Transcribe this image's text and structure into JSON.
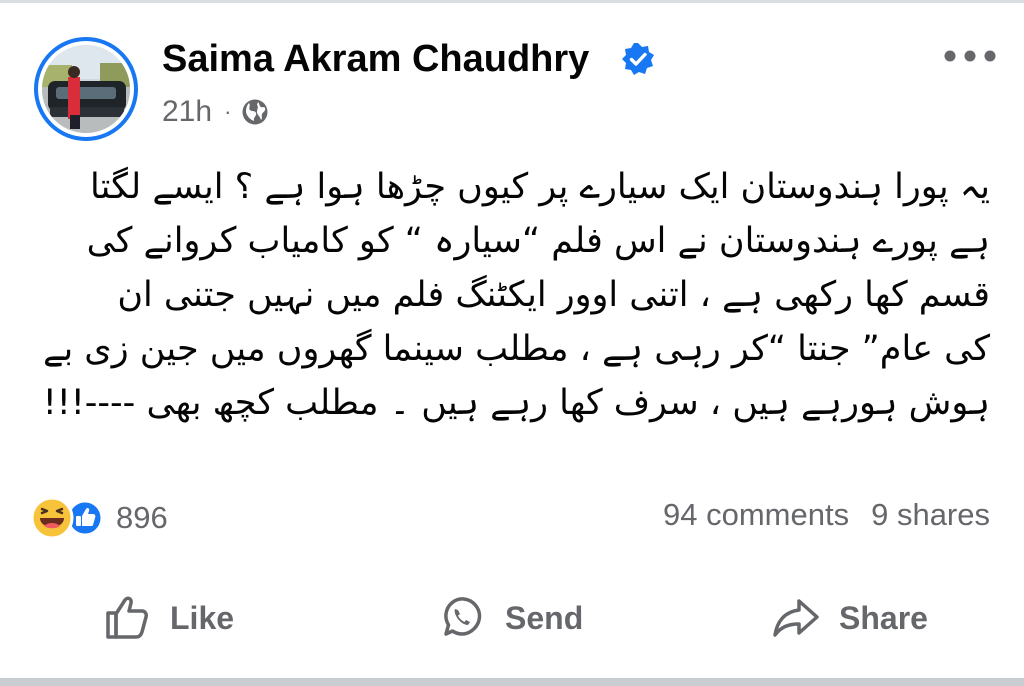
{
  "post": {
    "author": {
      "name": "Saima Akram Chaudhry",
      "verified": true
    },
    "time": "21h",
    "separator": "·",
    "privacy_icon": "globe-icon",
    "text_lines": [
      "یہ پورا ہندوستان ایک سیارے پر کیوں چڑھا ہوا ہے ؟ ایسے لگتا",
      "ہے پورے ہندوستان نے اس فلم “سیارہ “ کو کامیاب کروانے کی",
      "قسم کھا رکھی  ہے ، اتنی اوور ایکٹنگ فلم میں نہیں جتنی ان",
      "کی عام” جنتا “کر رہی ہے ، مطلب سینما گھروں میں جین زی بے",
      "ہوش ہورہے ہیں ، سرف کھا رہے ہیں ۔ مطلب کچھ بھی ----!!!"
    ],
    "reactions": {
      "icons": [
        "haha-icon",
        "like-icon"
      ],
      "count": "896"
    },
    "comments": "94 comments",
    "shares": "9 shares",
    "actions": {
      "like_label": "Like",
      "send_label": "Send",
      "share_label": "Share"
    }
  },
  "colors": {
    "brand_blue": "#1877f2",
    "secondary_text": "#65676b",
    "haha_yellow": "#f7c33b"
  }
}
